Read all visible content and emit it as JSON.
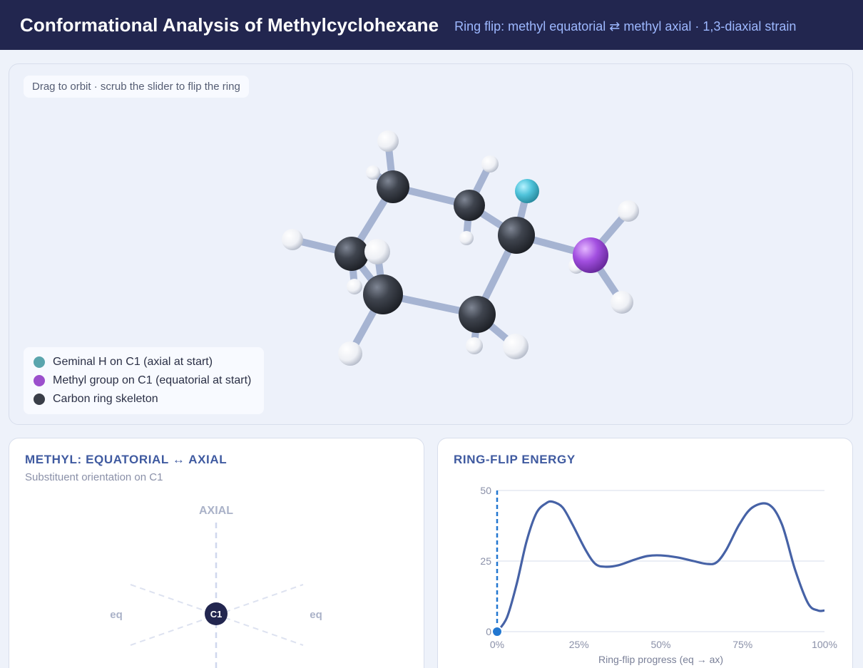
{
  "header": {
    "title": "Conformational Analysis of Methylcyclohexane",
    "subtitle": "Ring flip: methyl equatorial ⇄ methyl axial · 1,3-diaxial strain"
  },
  "viewer": {
    "hint": "Drag to orbit · scrub the slider to flip the ring",
    "legend": [
      {
        "label": "Geminal H on C1 (axial at start)",
        "color": "#5aa5ad"
      },
      {
        "label": "Methyl group on C1 (equatorial at start)",
        "color": "#9b4fcc"
      },
      {
        "label": "Carbon ring skeleton",
        "color": "#393e48"
      }
    ]
  },
  "orientation_panel": {
    "title": "METHYL: EQUATORIAL ↔ AXIAL",
    "subtitle": "Substituent orientation on C1",
    "axial_label": "AXIAL",
    "eq_left_label": "eq",
    "eq_right_label": "eq",
    "center_label": "C1"
  },
  "energy_panel": {
    "title": "RING-FLIP ENERGY",
    "chart_data": {
      "type": "line",
      "title": "RING-FLIP ENERGY",
      "xlabel": "Ring-flip progress (eq → ax)",
      "ylabel": "",
      "x_tick_labels": [
        "0%",
        "25%",
        "50%",
        "75%",
        "100%"
      ],
      "y_ticks": [
        0,
        25,
        50
      ],
      "xlim": [
        0,
        100
      ],
      "ylim": [
        0,
        50
      ],
      "grid": true,
      "current_progress": 0,
      "x": [
        0,
        3,
        6,
        9,
        12,
        15,
        17,
        20,
        23,
        27,
        30,
        33,
        37,
        42,
        46,
        50,
        55,
        60,
        64,
        67,
        70,
        74,
        78,
        83,
        87,
        91,
        95,
        98,
        100
      ],
      "y": [
        0,
        5,
        17,
        32,
        42,
        45.5,
        46,
        44,
        38,
        29,
        24,
        23,
        23.5,
        25.5,
        26.8,
        27,
        26.3,
        25,
        24,
        24.5,
        29,
        38,
        44,
        45,
        38,
        22,
        10,
        7.5,
        7.5
      ]
    }
  },
  "colors": {
    "header_bg": "#22264f",
    "accent": "#3f5aa0",
    "curve": "#4662a6",
    "marker": "#2277d0"
  }
}
